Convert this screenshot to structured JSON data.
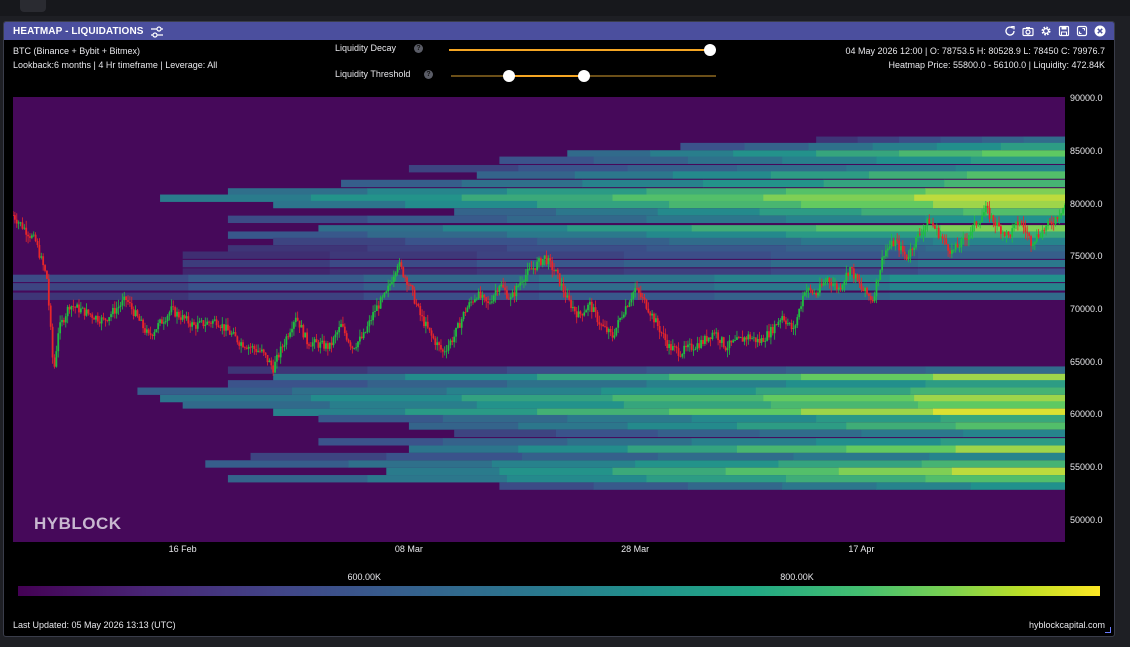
{
  "panel": {
    "title": "HEATMAP - LIQUIDATIONS",
    "title_icons": [
      "refresh-icon",
      "camera-icon",
      "gear-icon",
      "save-icon",
      "expand-icon",
      "close-icon"
    ]
  },
  "info": {
    "pair": "BTC (Binance + Bybit + Bitmex)",
    "settings": "Lookback:6 months | 4 Hr timeframe | Leverage: All",
    "ohlc": "04 May 2026 12:00 | O: 78753.5 H: 80528.9 L: 78450 C: 79976.7",
    "heatmap_price": "Heatmap Price: 55800.0 - 56100.0 | Liquidity: 472.84K"
  },
  "controls": {
    "decay": {
      "label": "Liquidity Decay",
      "value": 1.0
    },
    "threshold": {
      "label": "Liquidity Threshold",
      "range": [
        0.22,
        0.5
      ]
    },
    "help_symbol": "?"
  },
  "colors": {
    "background": "#46095a",
    "candle_up": "#1fbf3f",
    "candle_down": "#e8262a",
    "slider_accent": "#f5a623",
    "header": "#4b4f9e"
  },
  "watermark": "HYBLOCK",
  "chart_data": {
    "type": "heatmap",
    "title": "HEATMAP - LIQUIDATIONS",
    "y_ticks": [
      "90000.0",
      "85000.0",
      "80000.0",
      "75000.0",
      "70000.0",
      "65000.0",
      "60000.0",
      "55000.0",
      "50000.0"
    ],
    "ylim": [
      48000,
      90200
    ],
    "x_ticks": [
      {
        "label": "16 Feb",
        "day": 16
      },
      {
        "label": "08 Mar",
        "day": 36
      },
      {
        "label": "28 Mar",
        "day": 56
      },
      {
        "label": "17 Apr",
        "day": 76
      }
    ],
    "xlim": [
      1,
      94
    ],
    "price_anchors": [
      [
        1,
        79000
      ],
      [
        3,
        76500
      ],
      [
        4,
        73000
      ],
      [
        4.6,
        64000
      ],
      [
        5,
        68000
      ],
      [
        6,
        70500
      ],
      [
        9,
        69000
      ],
      [
        11,
        71000
      ],
      [
        13,
        67500
      ],
      [
        15,
        70000
      ],
      [
        17,
        68500
      ],
      [
        19,
        69000
      ],
      [
        21,
        67000
      ],
      [
        23,
        66000
      ],
      [
        24,
        64500
      ],
      [
        25,
        67000
      ],
      [
        26,
        69500
      ],
      [
        27,
        67000
      ],
      [
        29,
        66500
      ],
      [
        30,
        68500
      ],
      [
        31,
        66500
      ],
      [
        32,
        67500
      ],
      [
        33,
        70000
      ],
      [
        34,
        71500
      ],
      [
        35,
        74500
      ],
      [
        36,
        72500
      ],
      [
        37,
        69500
      ],
      [
        38,
        67500
      ],
      [
        39,
        66000
      ],
      [
        40,
        67500
      ],
      [
        41,
        70000
      ],
      [
        42,
        71500
      ],
      [
        43,
        70500
      ],
      [
        44,
        72500
      ],
      [
        45,
        71000
      ],
      [
        46,
        73000
      ],
      [
        47,
        74000
      ],
      [
        48,
        75000
      ],
      [
        49,
        73500
      ],
      [
        50,
        71000
      ],
      [
        51,
        69500
      ],
      [
        52,
        70500
      ],
      [
        53,
        68500
      ],
      [
        54,
        67500
      ],
      [
        55,
        70000
      ],
      [
        56,
        72000
      ],
      [
        57,
        70500
      ],
      [
        58,
        68500
      ],
      [
        59,
        66500
      ],
      [
        60,
        66000
      ],
      [
        61,
        66500
      ],
      [
        62,
        67000
      ],
      [
        63,
        68000
      ],
      [
        64,
        66500
      ],
      [
        65,
        67000
      ],
      [
        66,
        67500
      ],
      [
        67,
        67000
      ],
      [
        68,
        68000
      ],
      [
        69,
        69500
      ],
      [
        70,
        68000
      ],
      [
        71,
        72000
      ],
      [
        72,
        71500
      ],
      [
        73,
        73000
      ],
      [
        74,
        72000
      ],
      [
        75,
        74000
      ],
      [
        76,
        72000
      ],
      [
        77,
        71000
      ],
      [
        78,
        75500
      ],
      [
        79,
        76500
      ],
      [
        80,
        75000
      ],
      [
        81,
        77000
      ],
      [
        82,
        78500
      ],
      [
        83,
        77000
      ],
      [
        84,
        75500
      ],
      [
        85,
        76500
      ],
      [
        86,
        78000
      ],
      [
        87,
        79500
      ],
      [
        88,
        78000
      ],
      [
        89,
        77000
      ],
      [
        90,
        78500
      ],
      [
        91,
        76500
      ],
      [
        92,
        77500
      ],
      [
        93,
        78500
      ],
      [
        94,
        79976.7
      ]
    ],
    "liquidity_bands": [
      {
        "price": 86100,
        "start": 72,
        "intensity": 0.35
      },
      {
        "price": 85500,
        "start": 60,
        "intensity": 0.55
      },
      {
        "price": 84800,
        "start": 50,
        "intensity": 0.75
      },
      {
        "price": 84200,
        "start": 44,
        "intensity": 0.55
      },
      {
        "price": 83400,
        "start": 36,
        "intensity": 0.45
      },
      {
        "price": 82800,
        "start": 42,
        "intensity": 0.7
      },
      {
        "price": 82000,
        "start": 30,
        "intensity": 0.65
      },
      {
        "price": 81200,
        "start": 20,
        "intensity": 0.8
      },
      {
        "price": 80600,
        "start": 14,
        "intensity": 0.9
      },
      {
        "price": 80000,
        "start": 24,
        "intensity": 0.85
      },
      {
        "price": 79300,
        "start": 40,
        "intensity": 0.7
      },
      {
        "price": 78600,
        "start": 20,
        "intensity": 0.5
      },
      {
        "price": 77700,
        "start": 28,
        "intensity": 0.8
      },
      {
        "price": 77100,
        "start": 20,
        "intensity": 0.6
      },
      {
        "price": 76500,
        "start": 24,
        "intensity": 0.45
      },
      {
        "price": 75800,
        "start": 20,
        "intensity": 0.35
      },
      {
        "price": 75200,
        "start": 16,
        "intensity": 0.3
      },
      {
        "price": 74400,
        "start": 16,
        "intensity": 0.4
      },
      {
        "price": 73600,
        "start": 16,
        "intensity": 0.25
      },
      {
        "price": 73000,
        "start": 1,
        "intensity": 0.5
      },
      {
        "price": 72200,
        "start": 1,
        "intensity": 0.45
      },
      {
        "price": 71300,
        "start": 1,
        "intensity": 0.35
      },
      {
        "price": 64300,
        "start": 20,
        "intensity": 0.35
      },
      {
        "price": 63600,
        "start": 24,
        "intensity": 0.85
      },
      {
        "price": 63000,
        "start": 20,
        "intensity": 0.55
      },
      {
        "price": 62300,
        "start": 12,
        "intensity": 0.65
      },
      {
        "price": 61600,
        "start": 14,
        "intensity": 0.85
      },
      {
        "price": 61000,
        "start": 16,
        "intensity": 0.75
      },
      {
        "price": 60300,
        "start": 24,
        "intensity": 0.95
      },
      {
        "price": 59700,
        "start": 28,
        "intensity": 0.6
      },
      {
        "price": 59000,
        "start": 36,
        "intensity": 0.7
      },
      {
        "price": 58300,
        "start": 40,
        "intensity": 0.45
      },
      {
        "price": 57500,
        "start": 28,
        "intensity": 0.55
      },
      {
        "price": 56800,
        "start": 36,
        "intensity": 0.85
      },
      {
        "price": 56100,
        "start": 22,
        "intensity": 0.45
      },
      {
        "price": 55400,
        "start": 18,
        "intensity": 0.65
      },
      {
        "price": 54700,
        "start": 34,
        "intensity": 0.9
      },
      {
        "price": 54000,
        "start": 20,
        "intensity": 0.7
      },
      {
        "price": 53300,
        "start": 44,
        "intensity": 0.5
      }
    ],
    "colorbar": {
      "labels": [
        {
          "text": "600.00K",
          "pos": 0.32
        },
        {
          "text": "800.00K",
          "pos": 0.72
        }
      ]
    }
  },
  "footer": {
    "last_updated": "Last Updated: 05 May 2026 13:13 (UTC)",
    "site": "hyblockcapital.com"
  }
}
